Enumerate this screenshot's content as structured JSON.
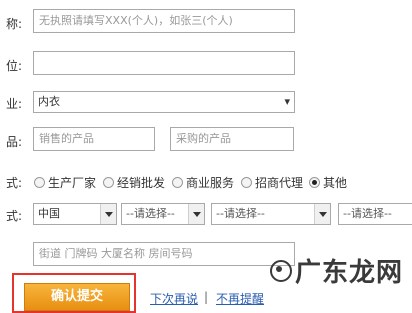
{
  "labels": {
    "name": "称:",
    "position": "位:",
    "industry": "业:",
    "products": "品:",
    "mode": "式:",
    "contact": "式:"
  },
  "name_field": {
    "placeholder": "无执照请填写XXX(个人)，如张三(个人)"
  },
  "industry_select": {
    "value": "内衣"
  },
  "products": {
    "sell_placeholder": "销售的产品",
    "buy_placeholder": "采购的产品"
  },
  "business_mode": {
    "options": [
      {
        "label": "生产厂家",
        "checked": false
      },
      {
        "label": "经销批发",
        "checked": false
      },
      {
        "label": "商业服务",
        "checked": false
      },
      {
        "label": "招商代理",
        "checked": false
      },
      {
        "label": "其他",
        "checked": true
      }
    ]
  },
  "address": {
    "country": "中国",
    "province": "--请选择--",
    "city": "--请选择--",
    "district": "--请选择--",
    "street_placeholder": "街道 门牌码 大厦名称 房间号码"
  },
  "actions": {
    "submit_label": "确认提交",
    "remind_later": "下次再说",
    "separator": "|",
    "no_remind": "不再提醒"
  },
  "watermark": {
    "text": "广东龙网"
  }
}
